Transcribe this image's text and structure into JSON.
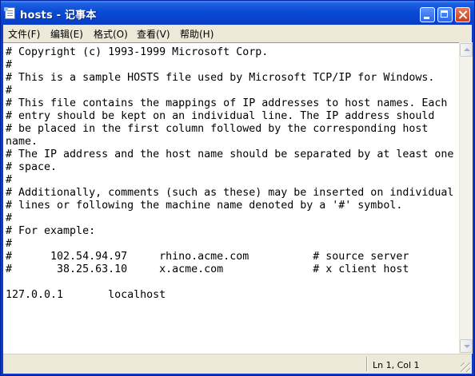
{
  "window": {
    "title": "hosts - 记事本",
    "buttons": {
      "minimize_icon": "minimize-icon",
      "maximize_icon": "maximize-icon",
      "close_icon": "close-icon"
    }
  },
  "menu": [
    {
      "label": "文件(F)"
    },
    {
      "label": "编辑(E)"
    },
    {
      "label": "格式(O)"
    },
    {
      "label": "查看(V)"
    },
    {
      "label": "帮助(H)"
    }
  ],
  "editor": {
    "content": "# Copyright (c) 1993-1999 Microsoft Corp.\n#\n# This is a sample HOSTS file used by Microsoft TCP/IP for Windows.\n#\n# This file contains the mappings of IP addresses to host names. Each\n# entry should be kept on an individual line. The IP address should\n# be placed in the first column followed by the corresponding host\nname.\n# The IP address and the host name should be separated by at least one\n# space.\n#\n# Additionally, comments (such as these) may be inserted on individual\n# lines or following the machine name denoted by a '#' symbol.\n#\n# For example:\n#\n#      102.54.94.97     rhino.acme.com          # source server\n#       38.25.63.10     x.acme.com              # x client host\n\n127.0.0.1       localhost"
  },
  "status": {
    "position": "Ln 1, Col 1"
  },
  "colors": {
    "titlebar": "#0a4bd6",
    "chrome": "#ece9d8",
    "editor_bg": "#ffffff"
  }
}
